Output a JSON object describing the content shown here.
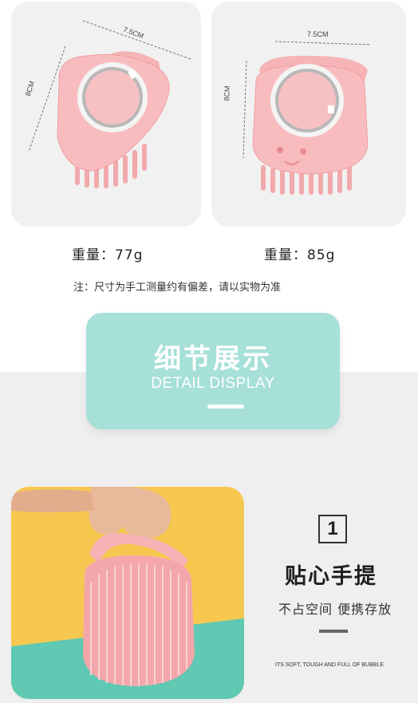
{
  "products": [
    {
      "width_label": "7.5CM",
      "height_label": "8CM",
      "weight_label": "重量：77g"
    },
    {
      "width_label": "7.5CM",
      "height_label": "8CM",
      "weight_label": "重量：85g"
    }
  ],
  "note": "注：尺寸为手工测量约有偏差，请以实物为准",
  "section": {
    "title_cn": "细节展示",
    "title_en": "DETAIL DISPLAY"
  },
  "feature": {
    "number": "1",
    "title": "贴心手提",
    "subtitle": "不占空间 便携存放",
    "tagline": "ITS SOFT, TOUGH AND FULL OF BUBBLE"
  },
  "colors": {
    "brush_pink": "#f6b4b6",
    "teal": "#a6e0d8",
    "yellow": "#f6c84f",
    "green": "#5fc9b3"
  }
}
